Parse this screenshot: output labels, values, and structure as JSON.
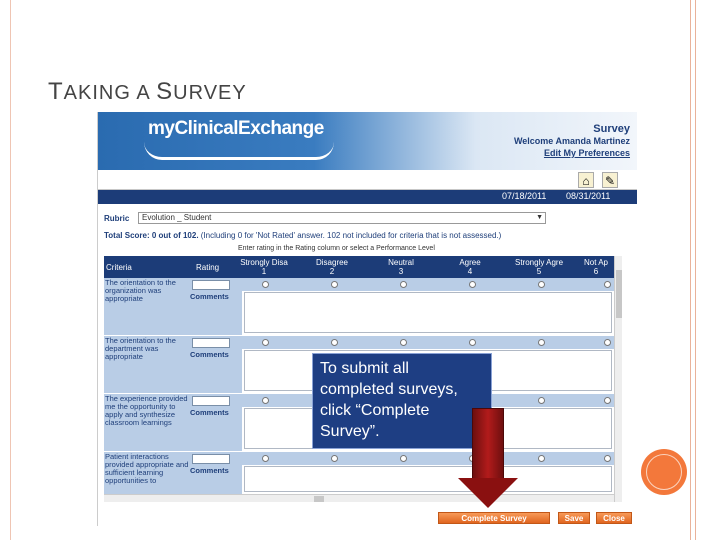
{
  "slide": {
    "title_first_letter": "T",
    "title_rest_1": "AKING A ",
    "title_second_letter": "S",
    "title_rest_2": "URVEY"
  },
  "app": {
    "logo": "myClinicalExchange",
    "page_label": "Survey",
    "welcome": "Welcome Amanda Martinez",
    "edit_prefs": "Edit My Preferences",
    "start_date": "07/18/2011",
    "end_date": "08/31/2011"
  },
  "form": {
    "rubric_label": "Rubric",
    "rubric_value": "Evolution _ Student",
    "total_score": "Total Score: 0 out of 102.",
    "total_note": "(Including 0 for 'Not Rated' answer. 102 not included for criteria that is not assessed.)",
    "instructions": "Enter rating in the Rating column or select a Performance Level",
    "columns": {
      "criteria": "Criteria",
      "rating": "Rating",
      "levels": [
        {
          "name": "Strongly Disa",
          "num": "1"
        },
        {
          "name": "Disagree",
          "num": "2"
        },
        {
          "name": "Neutral",
          "num": "3"
        },
        {
          "name": "Agree",
          "num": "4"
        },
        {
          "name": "Strongly Agre",
          "num": "5"
        },
        {
          "name": "Not Ap",
          "num": "6"
        }
      ]
    },
    "comments_label": "Comments",
    "rows": [
      {
        "criteria": "The orientation to the organization was appropriate"
      },
      {
        "criteria": "The orientation to the department was appropriate"
      },
      {
        "criteria": "The experience provided me the opportunity to apply and synthesize classroom learnings"
      },
      {
        "criteria": "Patient interactions provided appropriate and sufficient learning opportunities to"
      }
    ]
  },
  "buttons": {
    "complete": "Complete Survey",
    "save": "Save",
    "close": "Close"
  },
  "callout": {
    "text": "To submit all completed surveys, click “Complete Survey”."
  }
}
